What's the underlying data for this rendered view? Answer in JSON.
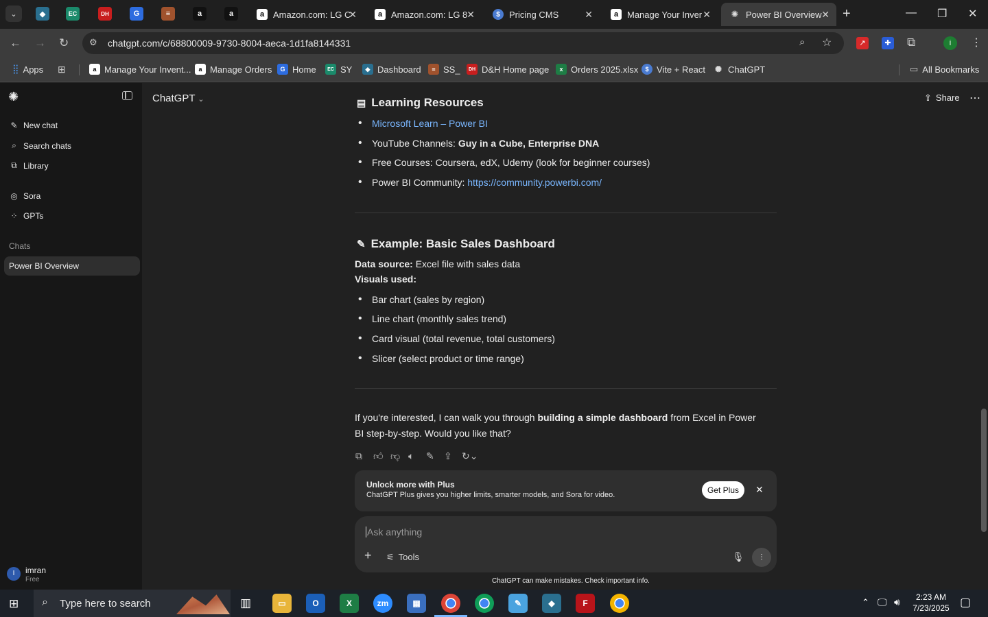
{
  "browser": {
    "tabs": [
      {
        "label": "Amazon.com: LG C"
      },
      {
        "label": "Amazon.com: LG 8"
      },
      {
        "label": "Pricing CMS"
      },
      {
        "label": "Manage Your Inver"
      },
      {
        "label": "Power BI Overview"
      }
    ],
    "url": "chatgpt.com/c/68800009-9730-8004-aeca-1d1fa8144331",
    "bookmarks": [
      {
        "label": "Apps"
      },
      {
        "label": "Manage Your Invent..."
      },
      {
        "label": "Manage Orders"
      },
      {
        "label": "Home"
      },
      {
        "label": "SY"
      },
      {
        "label": "Dashboard"
      },
      {
        "label": "SS_"
      },
      {
        "label": "D&H Home page"
      },
      {
        "label": "Orders 2025.xlsx"
      },
      {
        "label": "Vite + React"
      },
      {
        "label": "ChatGPT"
      }
    ],
    "all_bookmarks": "All Bookmarks"
  },
  "sidebar": {
    "new_chat": "New chat",
    "search_chats": "Search chats",
    "library": "Library",
    "sora": "Sora",
    "gpts": "GPTs",
    "chats_heading": "Chats",
    "active_chat": "Power BI Overview",
    "user_name": "imran",
    "user_plan": "Free",
    "user_initial": "I"
  },
  "header": {
    "model": "ChatGPT",
    "share": "Share"
  },
  "message": {
    "resources_heading": "Learning Resources",
    "resources": [
      {
        "link": "Microsoft Learn – Power BI"
      },
      {
        "prefix": "YouTube Channels: ",
        "bold": "Guy in a Cube, Enterprise DNA"
      },
      {
        "text": "Free Courses: Coursera, edX, Udemy (look for beginner courses)"
      },
      {
        "prefix": "Power BI Community: ",
        "link": "https://community.powerbi.com/"
      }
    ],
    "example_heading": "Example: Basic Sales Dashboard",
    "data_source_label": "Data source:",
    "data_source_value": " Excel file with sales data",
    "visuals_label": "Visuals used:",
    "visuals": [
      "Bar chart (sales by region)",
      "Line chart (monthly sales trend)",
      "Card visual (total revenue, total customers)",
      "Slicer (select product or time range)"
    ],
    "closing_prefix": "If you're interested, I can walk you through ",
    "closing_bold": "building a simple dashboard",
    "closing_suffix": " from Excel in Power BI step-by-step. Would you like that?"
  },
  "promo": {
    "title": "Unlock more with Plus",
    "body": "ChatGPT Plus gives you higher limits, smarter models, and Sora for video.",
    "button": "Get Plus"
  },
  "composer": {
    "placeholder": "Ask anything",
    "tools": "Tools",
    "disclaimer": "ChatGPT can make mistakes. Check important info."
  },
  "taskbar": {
    "search_placeholder": "Type here to search",
    "time": "2:23 AM",
    "date": "7/23/2025"
  }
}
